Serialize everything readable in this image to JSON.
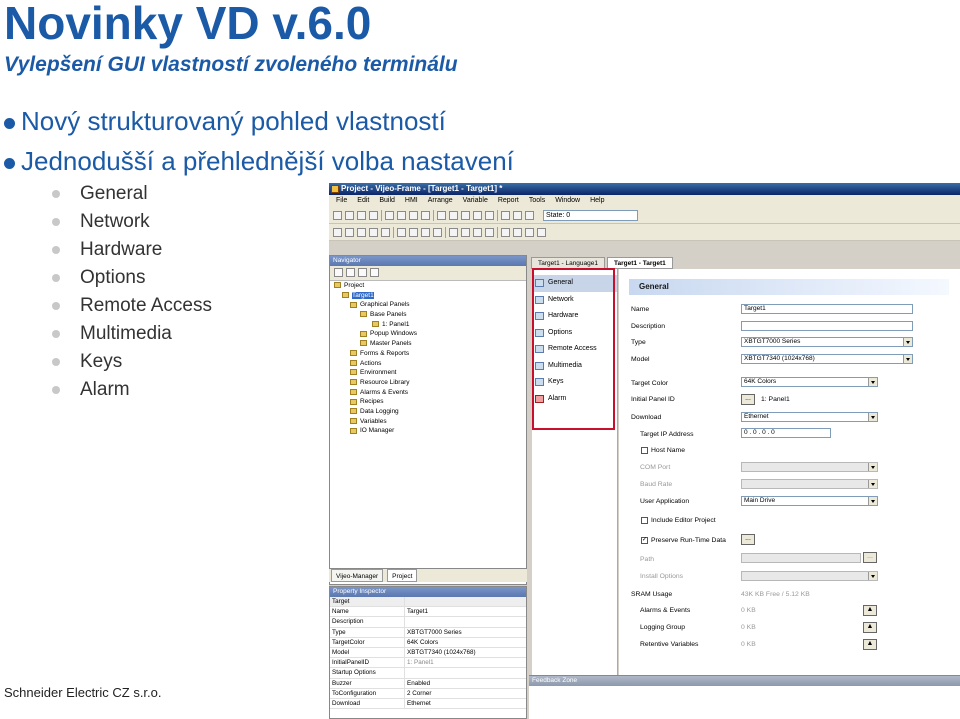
{
  "slide": {
    "title": "Novinky VD v.6.0",
    "subtitle": "Vylepšení GUI vlastností zvoleného terminálu",
    "bullets": [
      "Nový strukturovaný pohled vlastností",
      "Jednodušší a přehlednější volba nastavení"
    ],
    "sub_bullets": [
      "General",
      "Network",
      "Hardware",
      "Options",
      "Remote Access",
      "Multimedia",
      "Keys",
      "Alarm"
    ],
    "footer": "Schneider Electric CZ  s.r.o.",
    "accent_color": "#1b5aa6",
    "highlight_color": "#c8102e"
  },
  "app": {
    "window_title": "Project - Vijeo-Frame - [Target1 - Target1] *",
    "menu": [
      "File",
      "Edit",
      "Build",
      "HMI",
      "Arrange",
      "Variable",
      "Report",
      "Tools",
      "Window",
      "Help"
    ],
    "state_combo": "State: 0",
    "navigator": {
      "title": "Navigator",
      "tree": [
        {
          "label": "Project",
          "level": 0
        },
        {
          "label": "Target1",
          "level": 1,
          "selected": true
        },
        {
          "label": "Graphical Panels",
          "level": 2
        },
        {
          "label": "Base Panels",
          "level": 3
        },
        {
          "label": "1: Panel1",
          "level": 4
        },
        {
          "label": "Popup Windows",
          "level": 3
        },
        {
          "label": "Master Panels",
          "level": 3
        },
        {
          "label": "Forms & Reports",
          "level": 2
        },
        {
          "label": "Actions",
          "level": 2
        },
        {
          "label": "Environment",
          "level": 2
        },
        {
          "label": "Resource Library",
          "level": 2
        },
        {
          "label": "Alarms & Events",
          "level": 2
        },
        {
          "label": "Recipes",
          "level": 2
        },
        {
          "label": "Data Logging",
          "level": 2
        },
        {
          "label": "Variables",
          "level": 2
        },
        {
          "label": "IO Manager",
          "level": 2
        }
      ],
      "tabs": [
        "Vijeo-Manager",
        "Project"
      ]
    },
    "property_inspector": {
      "title": "Property Inspector",
      "header": "Target",
      "rows": [
        {
          "k": "Name",
          "v": "Target1"
        },
        {
          "k": "Description",
          "v": ""
        },
        {
          "k": "Type",
          "v": "XBTGT7000 Series"
        },
        {
          "k": "TargetColor",
          "v": "64K Colors"
        },
        {
          "k": "Model",
          "v": "XBTGT7340 (1024x768)"
        },
        {
          "k": "InitialPanelID",
          "v": "1: Panel1"
        },
        {
          "k": "Startup Options",
          "v": ""
        },
        {
          "k": "Buzzer",
          "v": "Enabled"
        },
        {
          "k": "ToConfiguration",
          "v": "2 Corner"
        },
        {
          "k": "Download",
          "v": "Ethernet"
        }
      ]
    },
    "doc_tabs": [
      "Target1 - Language1",
      "Target1 - Target1"
    ],
    "categories": [
      "General",
      "Network",
      "Hardware",
      "Options",
      "Remote Access",
      "Multimedia",
      "Keys",
      "Alarm"
    ],
    "form": {
      "heading": "General",
      "name_label": "Name",
      "name_value": "Target1",
      "description_label": "Description",
      "type_label": "Type",
      "type_value": "XBTGT7000 Series",
      "model_label": "Model",
      "model_value": "XBTGT7340 (1024x768)",
      "target_color_label": "Target Color",
      "target_color_value": "64K Colors",
      "initial_panel_label": "Initial Panel ID",
      "initial_panel_btn": "...",
      "initial_panel_value": "1: Panel1",
      "download_label": "Download",
      "download_value": "Ethernet",
      "target_ip_label": "Target IP Address",
      "target_ip_value": "0  .  0  .  0  .  0",
      "host_name_label": "Host Name",
      "com_port_label": "COM Port",
      "baud_rate_label": "Baud Rate",
      "user_app_label": "User Application",
      "user_app_value": "Main Drive",
      "include_editor_label": "Include Editor Project",
      "preserve_label": "Preserve Run-Time Data",
      "preserve_btn": "...",
      "path_label": "Path",
      "path_btn": "...",
      "install_label": "Install Options",
      "sram_label": "SRAM Usage",
      "sram_value": "43K KB Free / 5.12 KB",
      "alarms_label": "Alarms & Events",
      "alarms_value": "0 KB",
      "logging_label": "Logging Group",
      "logging_value": "0 KB",
      "retentive_label": "Retentive Variables",
      "retentive_value": "0 KB"
    },
    "feedback_title": "Feedback Zone"
  }
}
